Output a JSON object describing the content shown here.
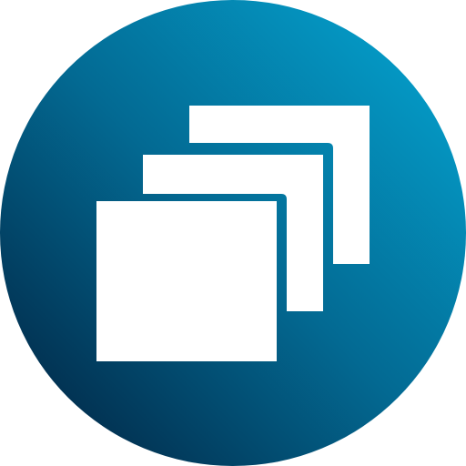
{
  "icon": {
    "name": "stacked-windows-icon",
    "colors": {
      "gradient_light": "#04a9d6",
      "gradient_mid": "#036a93",
      "gradient_dark": "#011d3a",
      "foreground": "#ffffff"
    }
  }
}
